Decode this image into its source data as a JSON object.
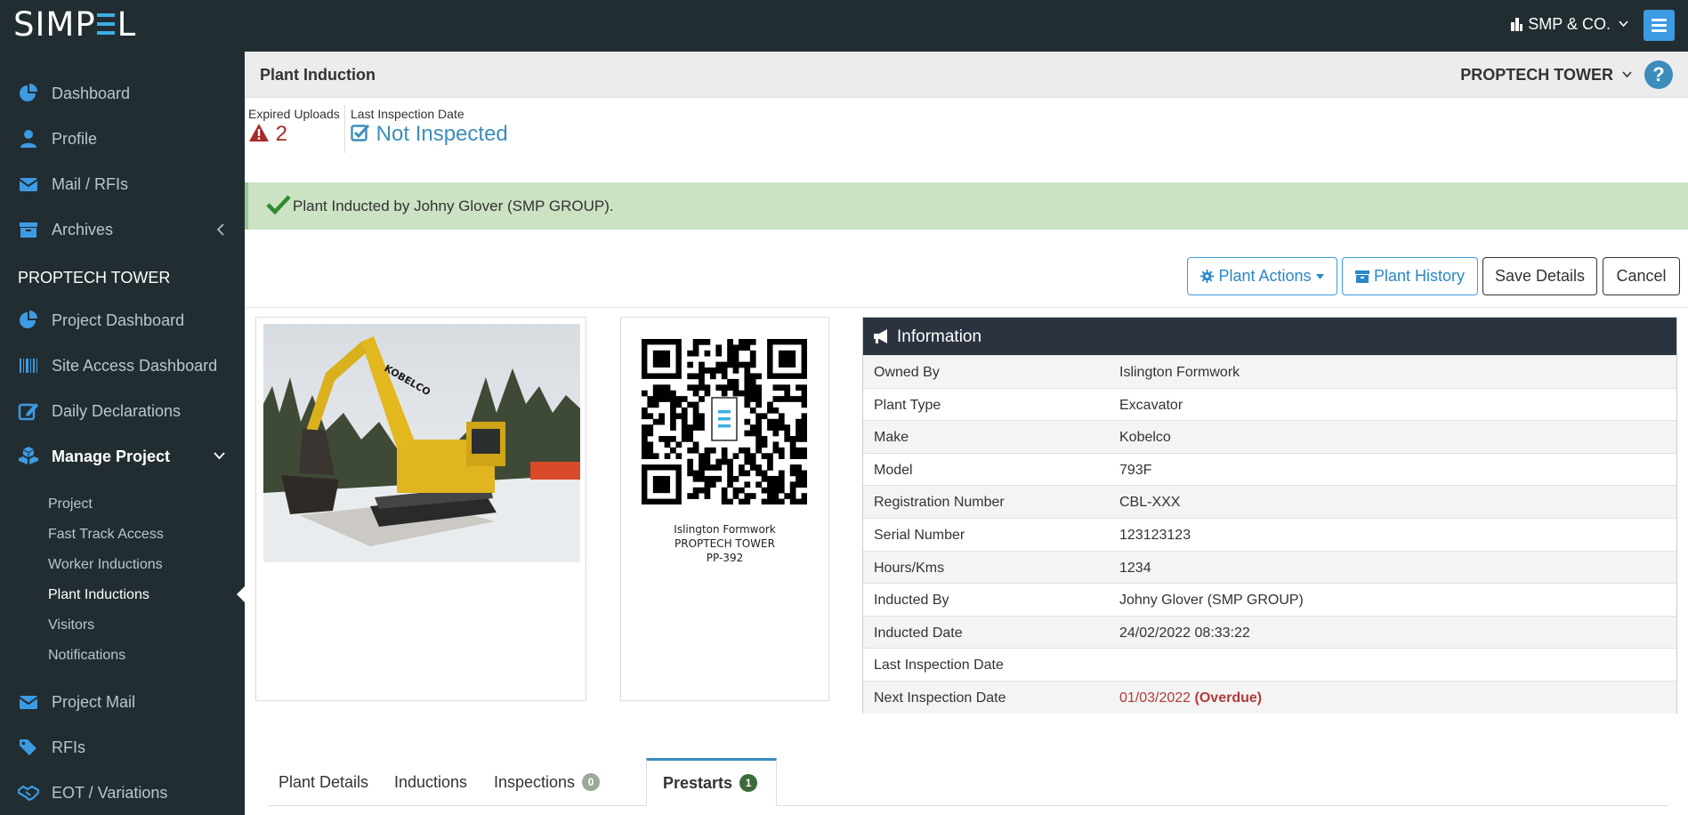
{
  "brand": {
    "logo_text_1": "SIMP",
    "logo_text_2": "L"
  },
  "topbar": {
    "company": "SMP & CO."
  },
  "sidebar": {
    "items": [
      {
        "label": "Dashboard"
      },
      {
        "label": "Profile"
      },
      {
        "label": "Mail / RFIs"
      },
      {
        "label": "Archives"
      }
    ],
    "section_title": "PROPTECH TOWER",
    "project_items": [
      {
        "label": "Project Dashboard"
      },
      {
        "label": "Site Access Dashboard"
      },
      {
        "label": "Daily Declarations"
      },
      {
        "label": "Manage Project"
      }
    ],
    "sub_items": [
      {
        "label": "Project"
      },
      {
        "label": "Fast Track Access"
      },
      {
        "label": "Worker Inductions"
      },
      {
        "label": "Plant Inductions"
      },
      {
        "label": "Visitors"
      },
      {
        "label": "Notifications"
      }
    ],
    "bottom_items": [
      {
        "label": "Project Mail"
      },
      {
        "label": "RFIs"
      },
      {
        "label": "EOT / Variations"
      }
    ]
  },
  "header": {
    "title": "Plant Induction",
    "project": "PROPTECH TOWER"
  },
  "stats": {
    "expired_label": "Expired Uploads",
    "expired_value": "2",
    "inspection_label": "Last Inspection Date",
    "inspection_value": "Not Inspected"
  },
  "alert": {
    "message": "Plant Inducted by Johny Glover (SMP GROUP)."
  },
  "actions": {
    "plant_actions": "Plant Actions",
    "plant_history": "Plant History",
    "save": "Save Details",
    "cancel": "Cancel"
  },
  "qr": {
    "line1": "Islington Formwork",
    "line2": "PROPTECH TOWER",
    "line3": "PP-392"
  },
  "info": {
    "title": "Information",
    "rows": [
      {
        "k": "Owned By",
        "v": "Islington Formwork"
      },
      {
        "k": "Plant Type",
        "v": "Excavator"
      },
      {
        "k": "Make",
        "v": "Kobelco"
      },
      {
        "k": "Model",
        "v": "793F"
      },
      {
        "k": "Registration Number",
        "v": "CBL-XXX"
      },
      {
        "k": "Serial Number",
        "v": "123123123"
      },
      {
        "k": "Hours/Kms",
        "v": "1234"
      },
      {
        "k": "Inducted By",
        "v": "Johny Glover (SMP GROUP)"
      },
      {
        "k": "Inducted Date",
        "v": "24/02/2022 08:33:22"
      },
      {
        "k": "Last Inspection Date",
        "v": ""
      },
      {
        "k": "Next Inspection Date",
        "v": "01/03/2022",
        "tag": "(Overdue)"
      }
    ]
  },
  "tabs": [
    {
      "label": "Plant Details"
    },
    {
      "label": "Inductions"
    },
    {
      "label": "Inspections",
      "badge": "0"
    },
    {
      "label": "Prestarts",
      "badge": "1"
    }
  ],
  "colors": {
    "sidebar_bg": "#222d32",
    "accent": "#3c8dbc",
    "alert_bg": "#cbe2c3",
    "overdue": "#b03a3a"
  },
  "photo": {
    "brand_text": "KOBELCO"
  }
}
